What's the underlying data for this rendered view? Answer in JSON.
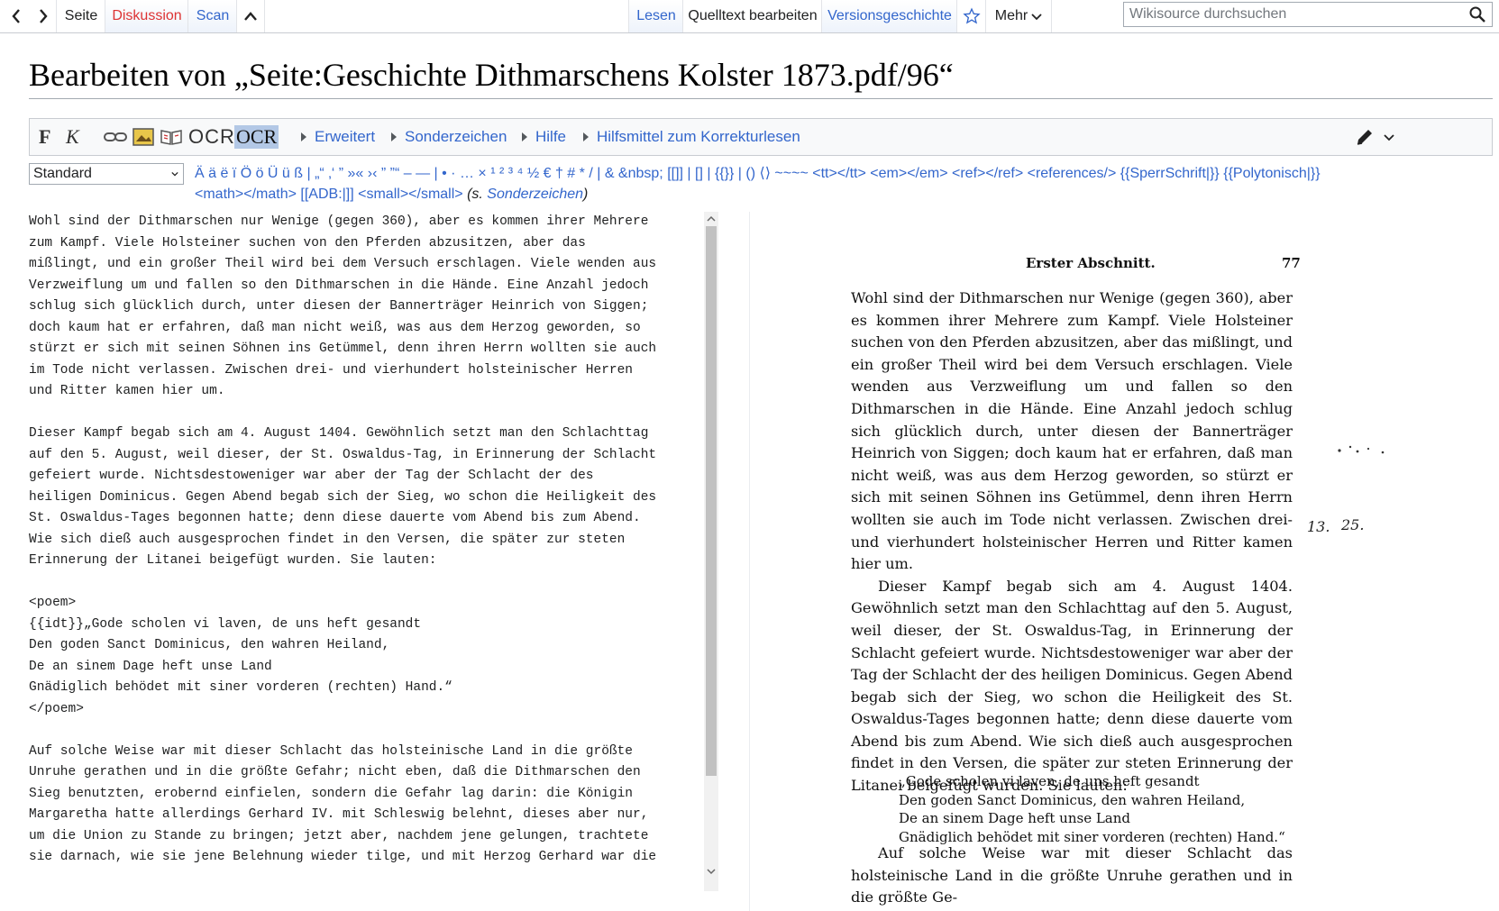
{
  "nav": {
    "back_icon": "chevron-left-icon",
    "forward_icon": "chevron-right-icon",
    "left_tabs": [
      {
        "label": "Seite"
      },
      {
        "label": "Diskussion"
      },
      {
        "label": "Scan"
      }
    ],
    "collapse_icon": "chevron-up-icon",
    "right_tabs": [
      {
        "label": "Lesen"
      },
      {
        "label": "Quelltext bearbeiten"
      },
      {
        "label": "Versionsgeschichte"
      }
    ],
    "watch_icon": "star-outline-icon",
    "more_label": "Mehr"
  },
  "search": {
    "placeholder": "Wikisource durchsuchen",
    "icon": "magnifier-icon"
  },
  "page": {
    "title": "Bearbeiten von „Seite:Geschichte Dithmarschens Kolster 1873.pdf/96“"
  },
  "toolbar": {
    "bold_label": "F",
    "italic_label": "K",
    "ocr_label": "OCR",
    "ocr2_label": "OCR",
    "menus": [
      "Erweitert",
      "Sonderzeichen",
      "Hilfe",
      "Hilfsmittel zum Korrekturlesen"
    ],
    "pencil_icon": "pencil-icon"
  },
  "specialchars": {
    "selected": "Standard",
    "line1": "Ä ä ë ï Ö ö Ü ü ß | „“ ‚‘ ” »« ›‹ ” ”“ – — | • · … × ¹ ² ³ ⁴ ½ € † # * / | & &nbsp; [[]] | [] | {{}} | () ⟨⟩ ~~~~ <tt></tt> <em></em> <ref></ref> <references/> {{SperrSchrift|}} {{Polytonisch|}}",
    "line2": "<math></math> [[ADB:|]] <small></small>",
    "note_prefix": "(s. ",
    "note_link": "Sonderzeichen",
    "note_suffix": ")"
  },
  "editor": {
    "text": "Wohl sind der Dithmarschen nur Wenige (gegen 360), aber es kommen ihrer Mehrere\nzum Kampf. Viele Holsteiner suchen von den Pferden abzusitzen, aber das\nmißlingt, und ein großer Theil wird bei dem Versuch erschlagen. Viele wenden aus\nVerzweiflung um und fallen so den Dithmarschen in die Hände. Eine Anzahl jedoch\nschlug sich glücklich durch, unter diesen der Bannerträger Heinrich von Siggen;\ndoch kaum hat er erfahren, daß man nicht weiß, was aus dem Herzog geworden, so\nstürzt er sich mit seinen Söhnen ins Getümmel, denn ihren Herrn wollten sie auch\nim Tode nicht verlassen. Zwischen drei- und vierhundert holsteinischer Herren\nund Ritter kamen hier um.\n\nDieser Kampf begab sich am 4. August 1404. Gewöhnlich setzt man den Schlachttag\nauf den 5. August, weil dieser, der St. Oswaldus-Tag, in Erinnerung der Schlacht\ngefeiert wurde. Nichtsdestoweniger war aber der Tag der Schlacht der des\nheiligen Dominicus. Gegen Abend begab sich der Sieg, wo schon die Heiligkeit des\nSt. Oswaldus-Tages begonnen hatte; denn diese dauerte vom Abend bis zum Abend.\nWie sich dieß auch ausgesprochen findet in den Versen, die später zur steten\nErinnerung der Litanei beigefügt wurden. Sie lauten:\n\n<poem>\n{{idt}}„Gode scholen vi laven, de uns heft gesandt\nDen goden Sanct Dominicus, den wahren Heiland,\nDe an sinem Dage heft unse Land\nGnädiglich behödet mit siner vorderen (rechten) Hand.“\n</poem>\n\nAuf solche Weise war mit dieser Schlacht das holsteinische Land in die größte\nUnruhe gerathen und in die größte Gefahr; nicht eben, daß die Dithmarschen den\nSieg benutzten, erobernd einfielen, sondern die Gefahr lag darin: die Königin\nMargaretha hatte allerdings Gerhard IV. mit Schleswig belehnt, dieses aber nur,\num die Union zu Stande zu bringen; jetzt aber, nachdem jene gelungen, trachtete\nsie darnach, wie sie jene Belehnung wieder tilge, und mit Herzog Gerhard war die"
  },
  "scan": {
    "header_title": "Erster Abschnitt.",
    "page_number": "77",
    "para1": "Wohl sind der Dithmarschen nur Wenige (gegen 360), aber es kommen ihrer Mehrere zum Kampf. Viele Holsteiner suchen von den Pferden abzusitzen, aber das mißlingt, und ein großer Theil wird bei dem Versuch erschlagen. Viele wenden aus Verzweiflung um und fallen so den Dithmarschen in die Hände. Eine Anzahl jedoch schlug sich glücklich durch, unter diesen der Bannerträger Heinrich von Siggen; doch kaum hat er erfahren, daß man nicht weiß, was aus dem Herzog geworden, so stürzt er sich mit seinen Söhnen ins Getümmel, denn ihren Herrn wollten sie auch im Tode nicht verlassen. Zwischen drei- und vierhundert holsteinischer Herren und Ritter kamen hier um.",
    "para2": "Dieser Kampf begab sich am 4. August 1404. Gewöhnlich setzt man den Schlachttag auf den 5. August, weil dieser, der St. Oswaldus-Tag, in Erinnerung der Schlacht gefeiert wurde. Nichtsdestoweniger war aber der Tag der Schlacht der des heiligen Dominicus. Gegen Abend begab sich der Sieg, wo schon die Heiligkeit des St. Oswaldus-Tages begonnen hatte; denn diese dauerte vom Abend bis zum Abend. Wie sich dieß auch ausgesprochen findet in den Versen, die später zur steten Erinnerung der Litanei beigefügt wurden. Sie lauten:",
    "poem": "„Gode scholen vi laven, de uns heft gesandt\nDen goden Sanct Dominicus, den wahren Heiland,\nDe an sinem Dage heft unse Land\nGnädiglich behödet mit siner vorderen (rechten) Hand.“",
    "para3": "Auf solche Weise war mit dieser Schlacht das holsteinische Land in die größte Unruhe gerathen und in die größte Ge-",
    "margin_note_1": "13.",
    "margin_note_2": "25."
  }
}
